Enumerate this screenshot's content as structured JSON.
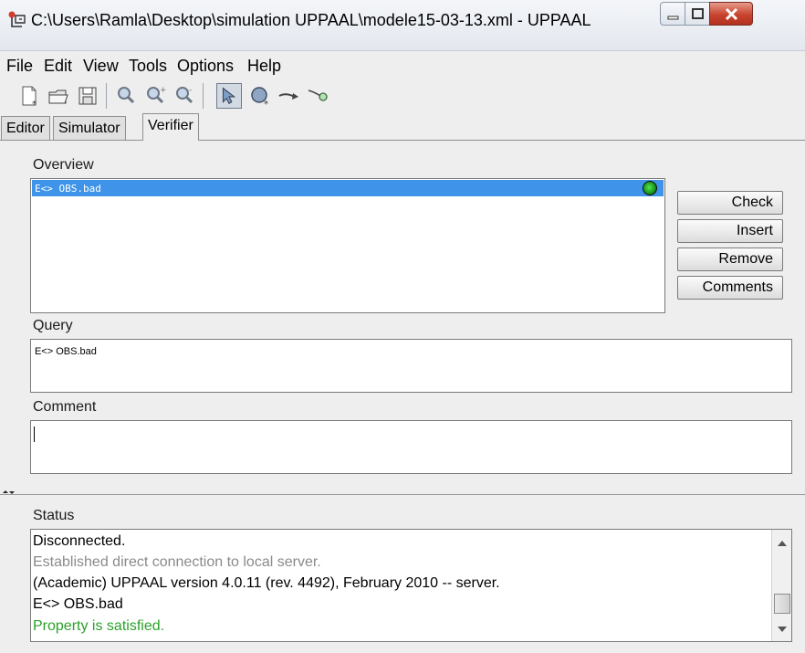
{
  "window": {
    "title": "C:\\Users\\Ramla\\Desktop\\simulation UPPAAL\\modele15-03-13.xml - UPPAAL",
    "controls": [
      "minimize-icon",
      "maximize-icon",
      "close-icon"
    ]
  },
  "menu": [
    "File",
    "Edit",
    "View",
    "Tools",
    "Options",
    "Help"
  ],
  "toolbar": [
    "new-file-icon",
    "open-folder-icon",
    "save-icon",
    "zoom-icon",
    "zoom-in-icon",
    "zoom-out-icon",
    "select-arrow-icon",
    "add-location-icon",
    "add-edge-icon",
    "add-nail-icon"
  ],
  "tabs": [
    "Editor",
    "Simulator",
    "Verifier"
  ],
  "selected_tab": "Verifier",
  "verifier": {
    "overview_label": "Overview",
    "queries": [
      {
        "text": "E<> OBS.bad",
        "status_color": "#2cc22a"
      }
    ],
    "buttons": {
      "check": "Check",
      "insert": "Insert",
      "remove": "Remove",
      "comments": "Comments"
    },
    "query_label": "Query",
    "query_text": "E<> OBS.bad",
    "comment_label": "Comment",
    "comment_text": ""
  },
  "status": {
    "label": "Status",
    "lines": [
      {
        "text": "Disconnected.",
        "color": "#000000"
      },
      {
        "text": "Established direct connection to local server.",
        "color": "#8a8a8a"
      },
      {
        "text": "(Academic) UPPAAL version 4.0.11 (rev. 4492), February 2010 -- server.",
        "color": "#000000"
      },
      {
        "text": "E<> OBS.bad",
        "color": "#000000"
      },
      {
        "text": "Property is satisfied.",
        "color": "#2aa12a"
      }
    ]
  }
}
